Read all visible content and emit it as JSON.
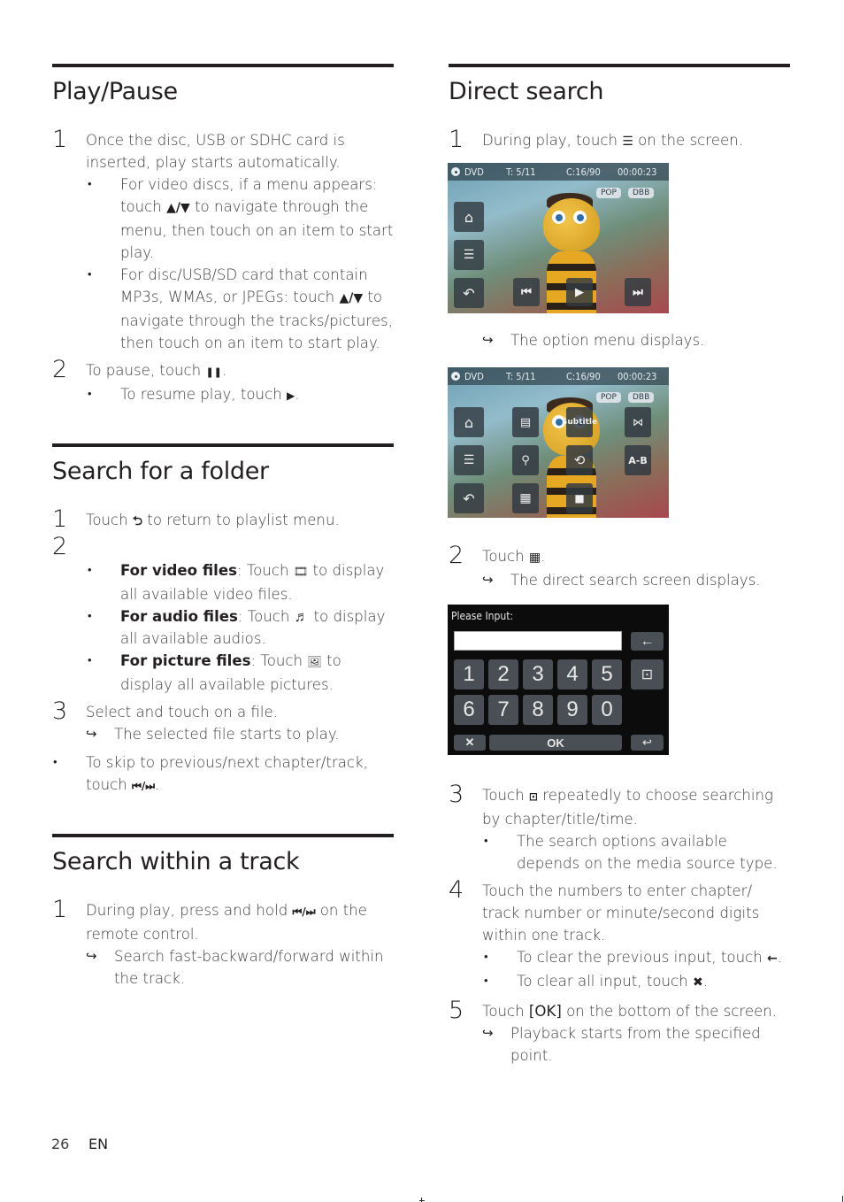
{
  "left_column": {
    "play_pause": {
      "title": "Play/Pause",
      "step1": {
        "num": "1",
        "text": "Once the disc, USB or SDHC card is inserted, play starts automatically.",
        "bullets": [
          {
            "pre": "For video discs, if a menu appears: touch ",
            "glyph": "▲/▼",
            "post": " to navigate through the menu, then touch on an item to start play."
          },
          {
            "pre": "For disc/USB/SD card that contain MP3s, WMAs, or JPEGs: touch ",
            "glyph": "▲/▼",
            "post": " to navigate through the tracks/pictures, then touch on an item to start play."
          }
        ]
      },
      "step2": {
        "num": "2",
        "pre": "To pause, touch ",
        "glyph": "❚❚",
        "post": ".",
        "bullet": {
          "pre": "To resume play, touch ",
          "glyph": "▶",
          "post": "."
        }
      }
    },
    "search_folder": {
      "title": "Search for a folder",
      "step1": {
        "num": "1",
        "pre": "Touch ",
        "glyph": "⮌",
        "post": " to return to playlist menu."
      },
      "step2": {
        "num": "2",
        "bullets": [
          {
            "bold": "For video files",
            "pre": ": Touch ",
            "glyph": "🎞",
            "post": " to display all available video files."
          },
          {
            "bold": "For audio files",
            "pre": ": Touch ",
            "glyph": "♬",
            "post": " to display all available audios."
          },
          {
            "bold": "For picture files",
            "pre": ": Touch ",
            "glyph": "🖼",
            "post": " to display all available pictures."
          }
        ]
      },
      "step3": {
        "num": "3",
        "text": "Select and touch on a file.",
        "result": "The selected file starts to play."
      },
      "note": {
        "pre": "To skip to previous/next chapter/track, touch ",
        "glyph": "⏮/⏭",
        "post": "."
      }
    },
    "search_track": {
      "title": "Search within a track",
      "step1": {
        "num": "1",
        "pre": "During play, press and hold ",
        "glyph": "⏮/⏭",
        "post": "  on the remote control.",
        "result": "Search fast-backward/forward within the track."
      }
    }
  },
  "right_column": {
    "direct_search": {
      "title": "Direct search",
      "step1": {
        "num": "1",
        "pre": "During play, touch ",
        "glyph": "☰",
        "post": " on the screen.",
        "result": "The option menu displays."
      },
      "step2": {
        "num": "2",
        "pre": "Touch ",
        "glyph": "▦",
        "post": ".",
        "result": "The direct search screen displays."
      },
      "step3": {
        "num": "3",
        "pre": "Touch ",
        "glyph": "⊡",
        "post": " repeatedly to choose searching by chapter/title/time.",
        "bullet": "The search options available depends on the media source type."
      },
      "step4": {
        "num": "4",
        "text": "Touch the numbers to enter chapter/ track number or minute/second digits within one track.",
        "bullets": [
          {
            "pre": "To clear the previous input, touch ",
            "glyph": "←",
            "post": "."
          },
          {
            "pre": "To clear all input, touch ",
            "glyph": "✖",
            "post": "."
          }
        ]
      },
      "step5": {
        "num": "5",
        "pre": "Touch ",
        "bold": "[OK]",
        "post": " on the bottom of the screen.",
        "result": "Playback starts from the specified point."
      }
    }
  },
  "screens": {
    "playback": {
      "source": "DVD",
      "title": "T: 5/11",
      "chapter": "C:16/90",
      "time": "00:00:23",
      "pills": [
        "POP",
        "DBB"
      ],
      "side_buttons": [
        "home-icon",
        "menu-icon",
        "back-icon"
      ],
      "controls": {
        "prev": "⏮",
        "play": "▶",
        "next": "⏭"
      }
    },
    "options": {
      "source": "DVD",
      "title": "T: 5/11",
      "chapter": "C:16/90",
      "time": "00:00:23",
      "pills": [
        "POP",
        "DBB"
      ],
      "subtitle_label": "Subtitle",
      "ab_label": "A-B"
    },
    "direct_input": {
      "prompt": "Please Input:",
      "field_value": "",
      "digits_row1": [
        "1",
        "2",
        "3",
        "4",
        "5"
      ],
      "digits_row2": [
        "6",
        "7",
        "8",
        "9",
        "0"
      ],
      "ok_label": "OK",
      "clear_glyph": "✕",
      "backspace_glyph": "←",
      "return_glyph": "↩",
      "mode_glyph": "⊡"
    }
  },
  "footer": {
    "page": "26",
    "lang": "EN"
  }
}
